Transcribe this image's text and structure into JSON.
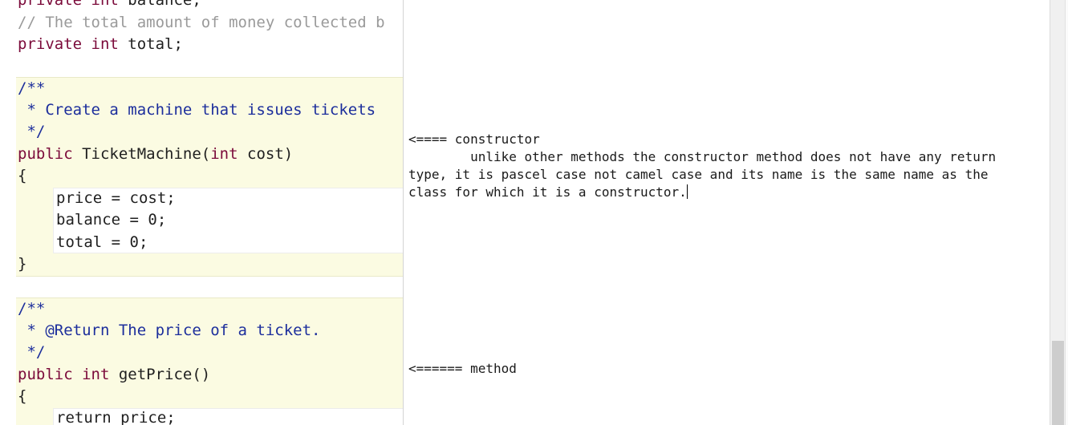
{
  "editor": {
    "lines": [
      {
        "kw": "private int",
        "text": " balance;"
      },
      {
        "comment": "// The total amount of money collected b"
      },
      {
        "kw": "private int",
        "text": " total;"
      },
      {
        "doc": "/**"
      },
      {
        "doc": " * Create a machine that issues tickets"
      },
      {
        "doc": " */"
      },
      {
        "kw1": "public",
        "text1": " TicketMachine(",
        "kw2": "int",
        "text2": " cost)"
      },
      {
        "text": "{"
      },
      {
        "text": "price = cost;"
      },
      {
        "text": "balance = 0;"
      },
      {
        "text": "total = 0;"
      },
      {
        "text": "}"
      },
      {
        "doc": "/**"
      },
      {
        "doc": " * @Return The price of a ticket."
      },
      {
        "doc": " */"
      },
      {
        "kw": "public int",
        "text": " getPrice()"
      },
      {
        "text": "{"
      },
      {
        "text": "return price;"
      }
    ]
  },
  "notes": {
    "constructor_arrow": "<==== constructor",
    "explanation_line1": "        unlike other methods the constructor method does not have any return",
    "explanation_line2": "type, it is pascel case not camel case and its name is the same name as the",
    "explanation_line3": "class for which it is a constructor.",
    "method_arrow": "<====== method"
  }
}
